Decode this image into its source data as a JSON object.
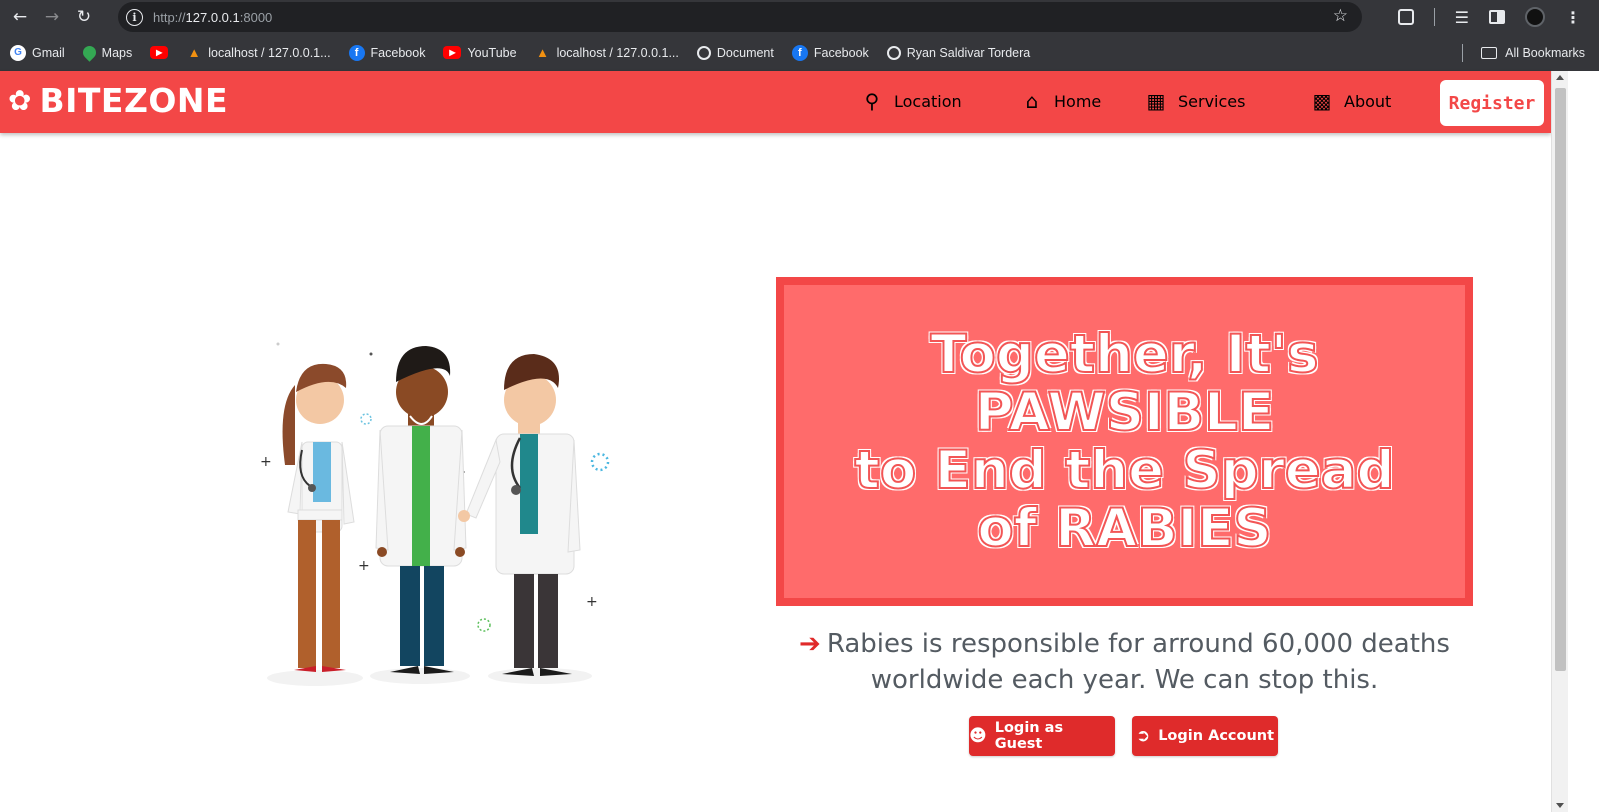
{
  "browser": {
    "url_prefix": "http://",
    "url_host": "127.0.0.1",
    "url_port": ":8000",
    "bookmarks": [
      {
        "label": "Gmail",
        "icon": "google-icon"
      },
      {
        "label": "Maps",
        "icon": "maps-icon"
      },
      {
        "label": "",
        "icon": "youtube-icon"
      },
      {
        "label": "localhost / 127.0.0.1...",
        "icon": "phpmyadmin-icon"
      },
      {
        "label": "Facebook",
        "icon": "facebook-icon"
      },
      {
        "label": "YouTube",
        "icon": "youtube-icon"
      },
      {
        "label": "localhost / 127.0.0.1...",
        "icon": "phpmyadmin-icon"
      },
      {
        "label": "Document",
        "icon": "globe-icon"
      },
      {
        "label": "Facebook",
        "icon": "facebook-icon"
      },
      {
        "label": "Ryan Saldivar Tordera",
        "icon": "globe-icon"
      }
    ],
    "all_bookmarks": "All Bookmarks"
  },
  "header": {
    "brand": "BITEZONE",
    "nav": [
      {
        "label": "Location",
        "icon": "map-pin-icon"
      },
      {
        "label": "Home",
        "icon": "home-icon"
      },
      {
        "label": "Services",
        "icon": "services-icon"
      },
      {
        "label": "About",
        "icon": "building-icon"
      }
    ],
    "register": "Register",
    "color": "#f34747"
  },
  "hero": {
    "headline_lines": [
      "Together, It's",
      "PAWSIBLE",
      "to End the Spread",
      "of RABIES"
    ],
    "stat_line1": "Rabies is responsible for arround 60,000 deaths",
    "stat_line2": "worldwide each year. We can stop this.",
    "guest_button": "Login as Guest",
    "account_button": "Login Account"
  }
}
